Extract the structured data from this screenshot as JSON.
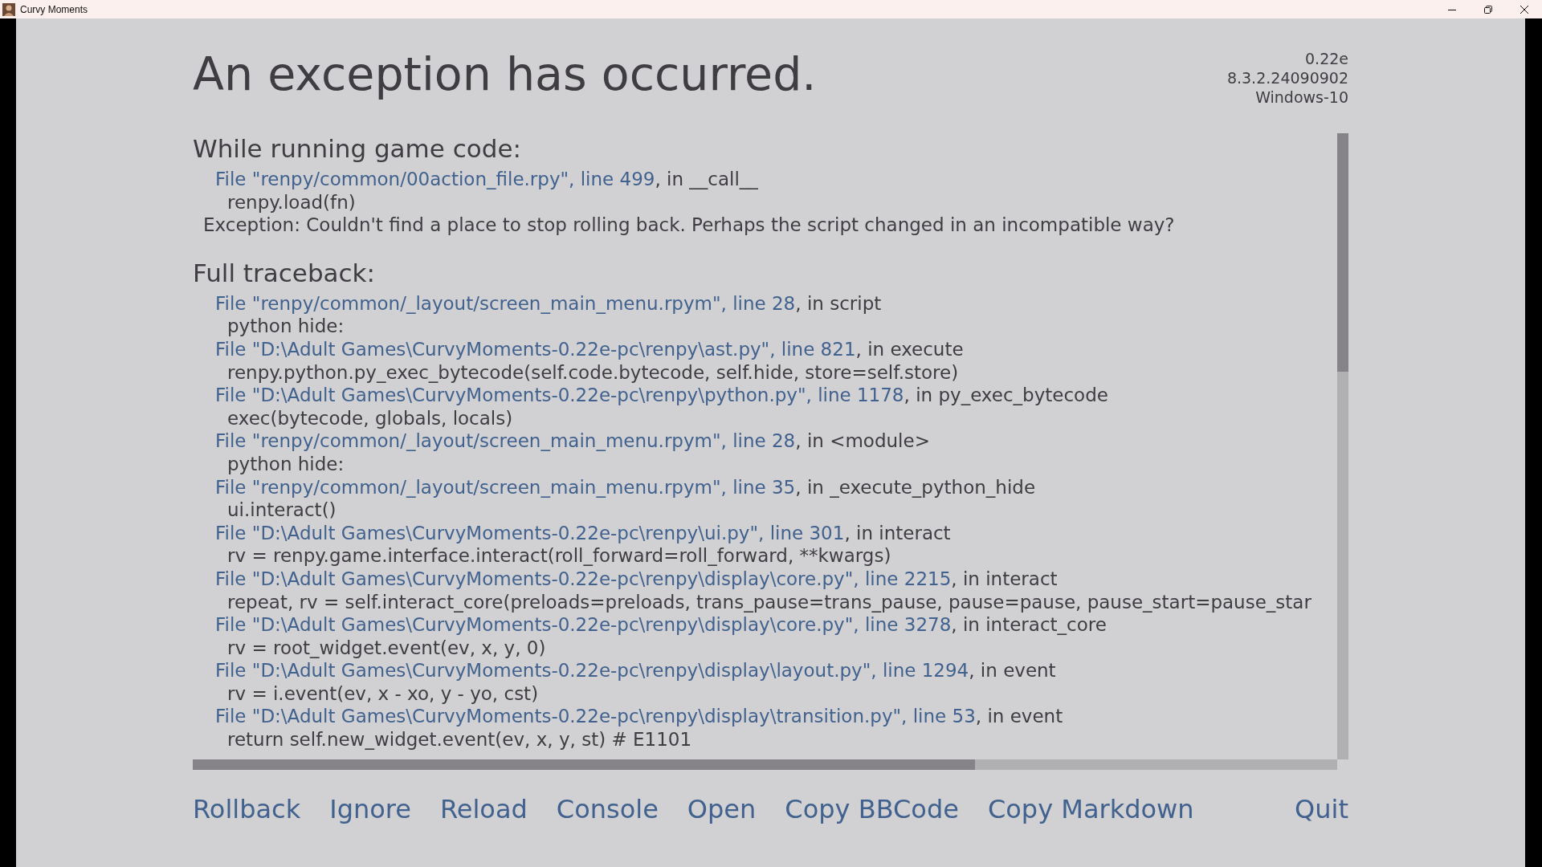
{
  "window": {
    "title": "Curvy Moments"
  },
  "heading": "An exception has occurred.",
  "version_info": [
    "0.22e",
    "8.3.2.24090902",
    "Windows-10"
  ],
  "game_code": {
    "heading": "While running game code:",
    "frames": [
      {
        "link": "File \"renpy/common/00action_file.rpy\", line 499",
        "suffix": ", in __call__",
        "code": "renpy.load(fn)"
      }
    ],
    "exception": "Exception: Couldn't find a place to stop rolling back. Perhaps the script changed in an incompatible way?"
  },
  "traceback": {
    "heading": "Full traceback:",
    "frames": [
      {
        "link": "File \"renpy/common/_layout/screen_main_menu.rpym\", line 28",
        "suffix": ", in script",
        "code": "python hide:"
      },
      {
        "link": "File \"D:\\Adult Games\\CurvyMoments-0.22e-pc\\renpy\\ast.py\", line 821",
        "suffix": ", in execute",
        "code": "renpy.python.py_exec_bytecode(self.code.bytecode, self.hide, store=self.store)"
      },
      {
        "link": "File \"D:\\Adult Games\\CurvyMoments-0.22e-pc\\renpy\\python.py\", line 1178",
        "suffix": ", in py_exec_bytecode",
        "code": "exec(bytecode, globals, locals)"
      },
      {
        "link": "File \"renpy/common/_layout/screen_main_menu.rpym\", line 28",
        "suffix": ", in <module>",
        "code": "python hide:"
      },
      {
        "link": "File \"renpy/common/_layout/screen_main_menu.rpym\", line 35",
        "suffix": ", in _execute_python_hide",
        "code": "ui.interact()"
      },
      {
        "link": "File \"D:\\Adult Games\\CurvyMoments-0.22e-pc\\renpy\\ui.py\", line 301",
        "suffix": ", in interact",
        "code": "rv = renpy.game.interface.interact(roll_forward=roll_forward, **kwargs)"
      },
      {
        "link": "File \"D:\\Adult Games\\CurvyMoments-0.22e-pc\\renpy\\display\\core.py\", line 2215",
        "suffix": ", in interact",
        "code": "repeat, rv = self.interact_core(preloads=preloads, trans_pause=trans_pause, pause=pause, pause_start=pause_star"
      },
      {
        "link": "File \"D:\\Adult Games\\CurvyMoments-0.22e-pc\\renpy\\display\\core.py\", line 3278",
        "suffix": ", in interact_core",
        "code": "rv = root_widget.event(ev, x, y, 0)"
      },
      {
        "link": "File \"D:\\Adult Games\\CurvyMoments-0.22e-pc\\renpy\\display\\layout.py\", line 1294",
        "suffix": ", in event",
        "code": "rv = i.event(ev, x - xo, y - yo, cst)"
      },
      {
        "link": "File \"D:\\Adult Games\\CurvyMoments-0.22e-pc\\renpy\\display\\transition.py\", line 53",
        "suffix": ", in event",
        "code": "return self.new_widget.event(ev, x, y, st) # E1101"
      }
    ]
  },
  "actions": [
    {
      "label": "Rollback",
      "kind": "left"
    },
    {
      "label": "Ignore",
      "kind": "left"
    },
    {
      "label": "Reload",
      "kind": "left"
    },
    {
      "label": "Console",
      "kind": "left"
    },
    {
      "label": "Open",
      "kind": "left"
    },
    {
      "label": "Copy BBCode",
      "kind": "left"
    },
    {
      "label": "Copy Markdown",
      "kind": "left"
    },
    {
      "label": "Quit",
      "kind": "right"
    }
  ]
}
